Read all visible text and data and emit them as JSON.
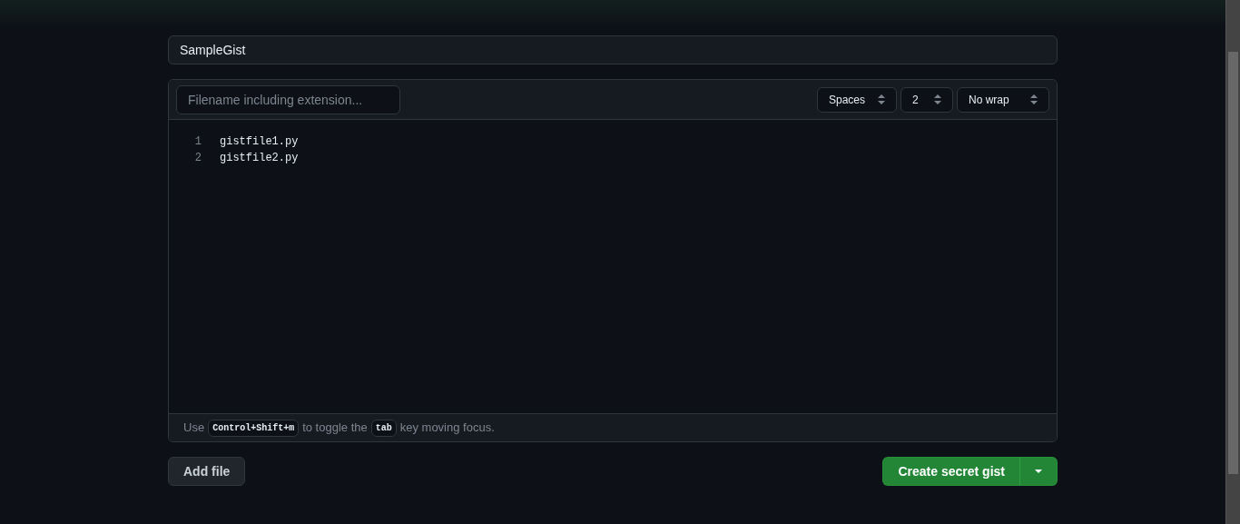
{
  "description_field": {
    "value": "SampleGist"
  },
  "file_editor": {
    "filename": {
      "placeholder": "Filename including extension..."
    },
    "selects": [
      {
        "value": "Spaces"
      },
      {
        "value": "2"
      },
      {
        "value": "No wrap"
      }
    ],
    "lines": [
      {
        "number": "1",
        "text": "gistfile1.py"
      },
      {
        "number": "2",
        "text": "gistfile2.py"
      }
    ],
    "hint": [
      {
        "kind": "text",
        "text": "Use"
      },
      {
        "kind": "kbd",
        "text": "Control+Shift+m"
      },
      {
        "kind": "text",
        "text": "to toggle the"
      },
      {
        "kind": "kbd",
        "text": "tab"
      },
      {
        "kind": "text",
        "text": "key moving focus."
      }
    ]
  },
  "add_file_button": "Add file",
  "create_button": "Create secret gist"
}
